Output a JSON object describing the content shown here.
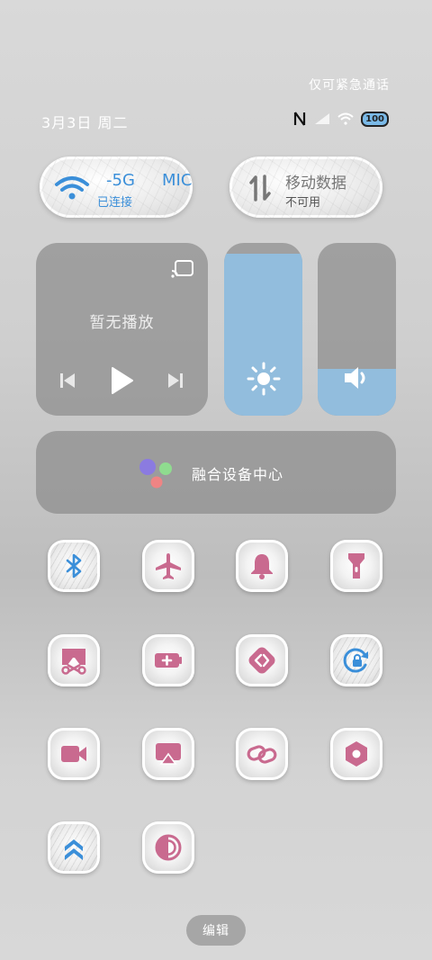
{
  "status": {
    "emergency_text": "仅可紧急通话",
    "date_text": "3月3日 周二",
    "battery_text": "100"
  },
  "wifi_tile": {
    "title": "-5G",
    "title_extra": "MIC",
    "subtitle": "已连接"
  },
  "data_tile": {
    "title": "移动数据",
    "subtitle": "不可用"
  },
  "media": {
    "no_play_text": "暂无播放"
  },
  "brightness": {
    "level": 0.94
  },
  "volume": {
    "level": 0.27
  },
  "device_center": {
    "label": "融合设备中心"
  },
  "quick_tiles": [
    "bluetooth-icon",
    "airplane-mode-icon",
    "bell-icon",
    "flashlight-icon",
    "screenshot-scissors-icon",
    "battery-saver-icon",
    "code-arrows-icon",
    "rotation-lock-icon",
    "video-camera-icon",
    "screen-cast-icon",
    "link-icon",
    "settings-hexagon-icon",
    "double-chevron-up-icon",
    "contrast-circle-icon"
  ],
  "colors": {
    "accent_blue": "#3b8fd9",
    "accent_pink": "#c96a8f",
    "slider_fill": "#92bddd"
  },
  "edit_button": {
    "label": "编辑"
  }
}
